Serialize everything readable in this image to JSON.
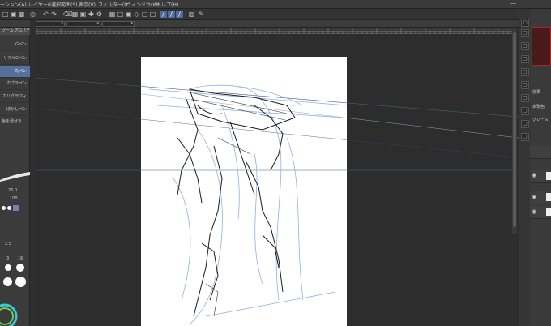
{
  "menu": {
    "items": [
      "ーション(A)",
      "レイヤー(L)",
      "選択範囲(S)",
      "表示(V)",
      "フィルター(I)",
      "ウィンドウ(W)",
      "ヘルプ(H)"
    ]
  },
  "tool_property": {
    "header": "ツールプロパティ",
    "brushes": [
      "Gペン",
      "リアルGペン",
      "丸ペン",
      "カブラペン",
      "カリグラフィ",
      "ぼかしペン"
    ],
    "selected_brush": "丸ペン",
    "option": "色を混ぜる",
    "size_value": "26.0",
    "opacity_value": "100",
    "brush_sizes": [
      "2.5",
      "3",
      "16"
    ]
  },
  "right_panel": {
    "effect_label": "効果",
    "color_label": "表現色",
    "grayscale_label": "グレース"
  },
  "colors": {
    "accent": "#566f9d",
    "paper": "#ffffff",
    "navigator_frame": "#a02a2a"
  }
}
